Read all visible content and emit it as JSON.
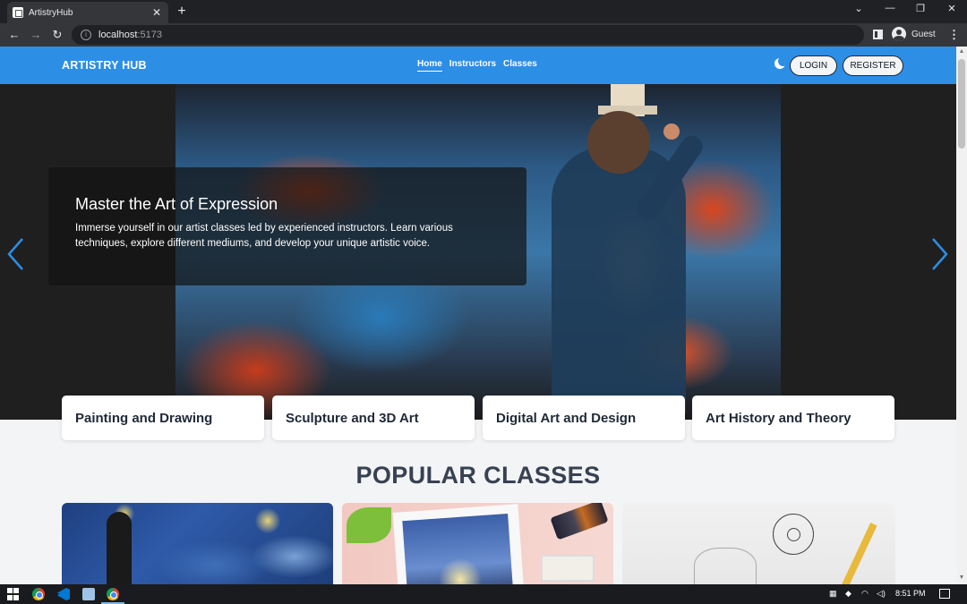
{
  "browser": {
    "tab_title": "ArtistryHub",
    "tab_close": "✕",
    "new_tab": "+",
    "url_host": "localhost",
    "url_port": ":5173",
    "profile_label": "Guest",
    "window_controls": [
      "⌄",
      "—",
      "❐",
      "✕"
    ]
  },
  "navbar": {
    "brand": "ARTISTRY HUB",
    "links": [
      "Home",
      "Instructors",
      "Classes"
    ],
    "active_link": "Home",
    "login_label": "LOGIN",
    "register_label": "REGISTER",
    "theme_icon": "moon-icon"
  },
  "hero": {
    "title": "Master the Art of Expression",
    "text": "Immerse yourself in our artist classes led by experienced instructors. Learn various techniques, explore different mediums, and develop your unique artistic voice.",
    "prev_icon": "chevron-left-icon",
    "next_icon": "chevron-right-icon"
  },
  "categories": [
    "Painting and Drawing",
    "Sculpture and 3D Art",
    "Digital Art and Design",
    "Art History and Theory"
  ],
  "popular": {
    "heading": "POPULAR CLASSES",
    "cards": [
      "starry-night-painting",
      "watercolor-lantern-painting",
      "pencil-flower-sketch"
    ]
  },
  "taskbar": {
    "time": "8:51 PM",
    "apps": [
      "windows-start-icon",
      "chrome-icon",
      "vscode-icon",
      "notepad-icon",
      "chrome-icon"
    ]
  },
  "colors": {
    "navbar": "#2d8ee6",
    "accent_arrow": "#2d8ee6",
    "heading": "#374151"
  }
}
